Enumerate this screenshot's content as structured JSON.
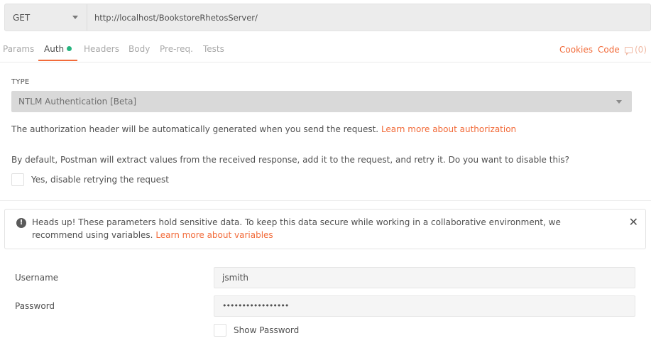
{
  "request": {
    "method": "GET",
    "url": "http://localhost/BookstoreRhetosServer/"
  },
  "tabs": [
    {
      "label": "Params",
      "active": false
    },
    {
      "label": "Auth",
      "active": true,
      "indicator_color": "#26b47f"
    },
    {
      "label": "Headers",
      "active": false
    },
    {
      "label": "Body",
      "active": false
    },
    {
      "label": "Pre-req.",
      "active": false
    },
    {
      "label": "Tests",
      "active": false
    }
  ],
  "right_links": {
    "cookies": "Cookies",
    "code": "Code",
    "comments": "(0)"
  },
  "auth": {
    "type_label": "TYPE",
    "type_value": "NTLM Authentication [Beta]",
    "info_text": "The authorization header will be automatically generated when you send the request.",
    "info_link": "Learn more about authorization",
    "retry_text": "By default, Postman will extract values from the received response, add it to the request, and retry it. Do you want to disable this?",
    "retry_checkbox_label": "Yes, disable retrying the request",
    "retry_checked": false
  },
  "alert": {
    "icon": "exclamation-icon",
    "text": "Heads up! These parameters hold sensitive data. To keep this data secure while working in a collaborative environment, we recommend using variables.",
    "link": "Learn more about variables"
  },
  "fields": {
    "username_label": "Username",
    "username_value": "jsmith",
    "password_label": "Password",
    "password_value": "•••••••••••••••••",
    "show_password_label": "Show Password",
    "show_password_checked": false
  },
  "colors": {
    "accent": "#f26b3a",
    "auth_dot": "#26b47f"
  }
}
